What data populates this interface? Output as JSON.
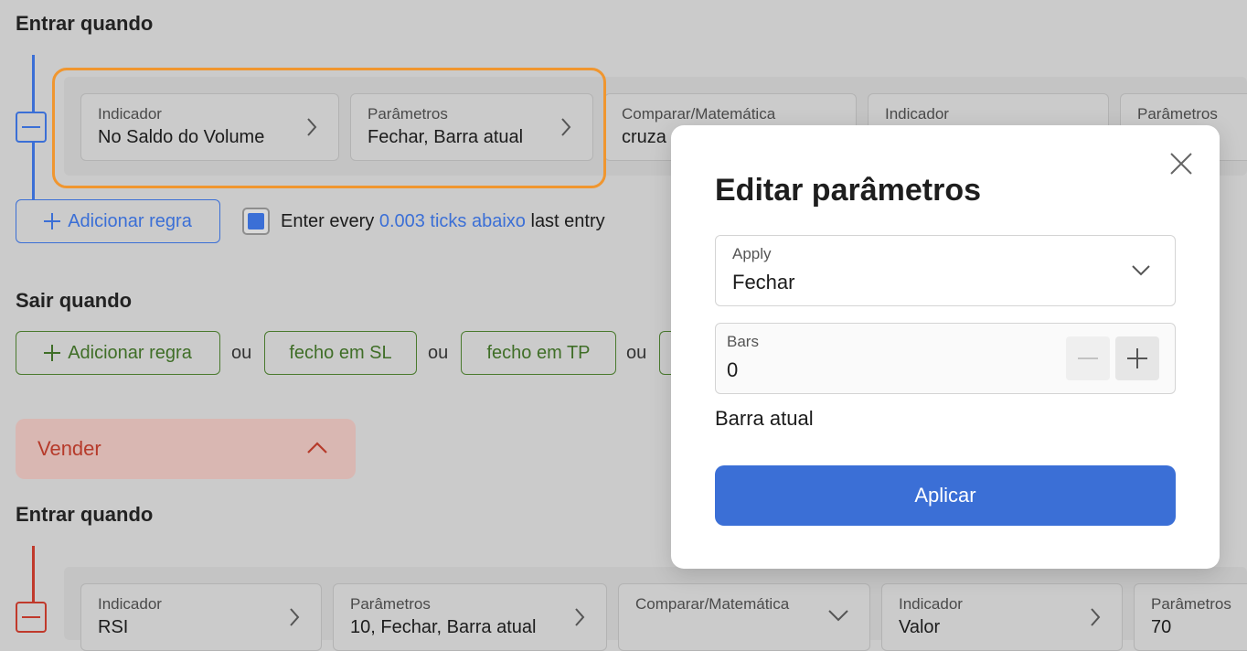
{
  "buy_section": {
    "enter_title": "Entrar quando",
    "rule_chips": [
      {
        "label": "Indicador",
        "value": "No Saldo do Volume"
      },
      {
        "label": "Parâmetros",
        "value": "Fechar, Barra atual"
      },
      {
        "label": "Comparar/Matemática",
        "value": "cruza"
      },
      {
        "label": "Indicador",
        "value": ""
      },
      {
        "label": "Parâmetros",
        "value": ""
      }
    ],
    "add_rule_label": "Adicionar regra",
    "enter_every": {
      "prefix": "Enter every ",
      "link": "0.003 ticks abaixo",
      "suffix": " last entry",
      "checked": true
    },
    "exit_title": "Sair quando",
    "exit_add_rule_label": "Adicionar regra",
    "ou": "ou",
    "exit_options": [
      "fecho em SL",
      "fecho em TP"
    ]
  },
  "sell_section": {
    "header_label": "Vender",
    "enter_title": "Entrar quando",
    "rule_chips": [
      {
        "label": "Indicador",
        "value": "RSI"
      },
      {
        "label": "Parâmetros",
        "value": "10, Fechar, Barra atual"
      },
      {
        "label": "Comparar/Matemática",
        "value": ""
      },
      {
        "label": "Indicador",
        "value": "Valor"
      },
      {
        "label": "Parâmetros",
        "value": "70"
      }
    ]
  },
  "modal": {
    "title": "Editar parâmetros",
    "apply_field": {
      "label": "Apply",
      "value": "Fechar"
    },
    "bars_field": {
      "label": "Bars",
      "value": "0"
    },
    "hint": "Barra atual",
    "apply_button": "Aplicar"
  },
  "colors": {
    "accent_blue": "#3b6fd6",
    "highlight_orange": "#f0962f",
    "sell_red": "#b63a2a",
    "exit_green": "#3f6e27"
  }
}
